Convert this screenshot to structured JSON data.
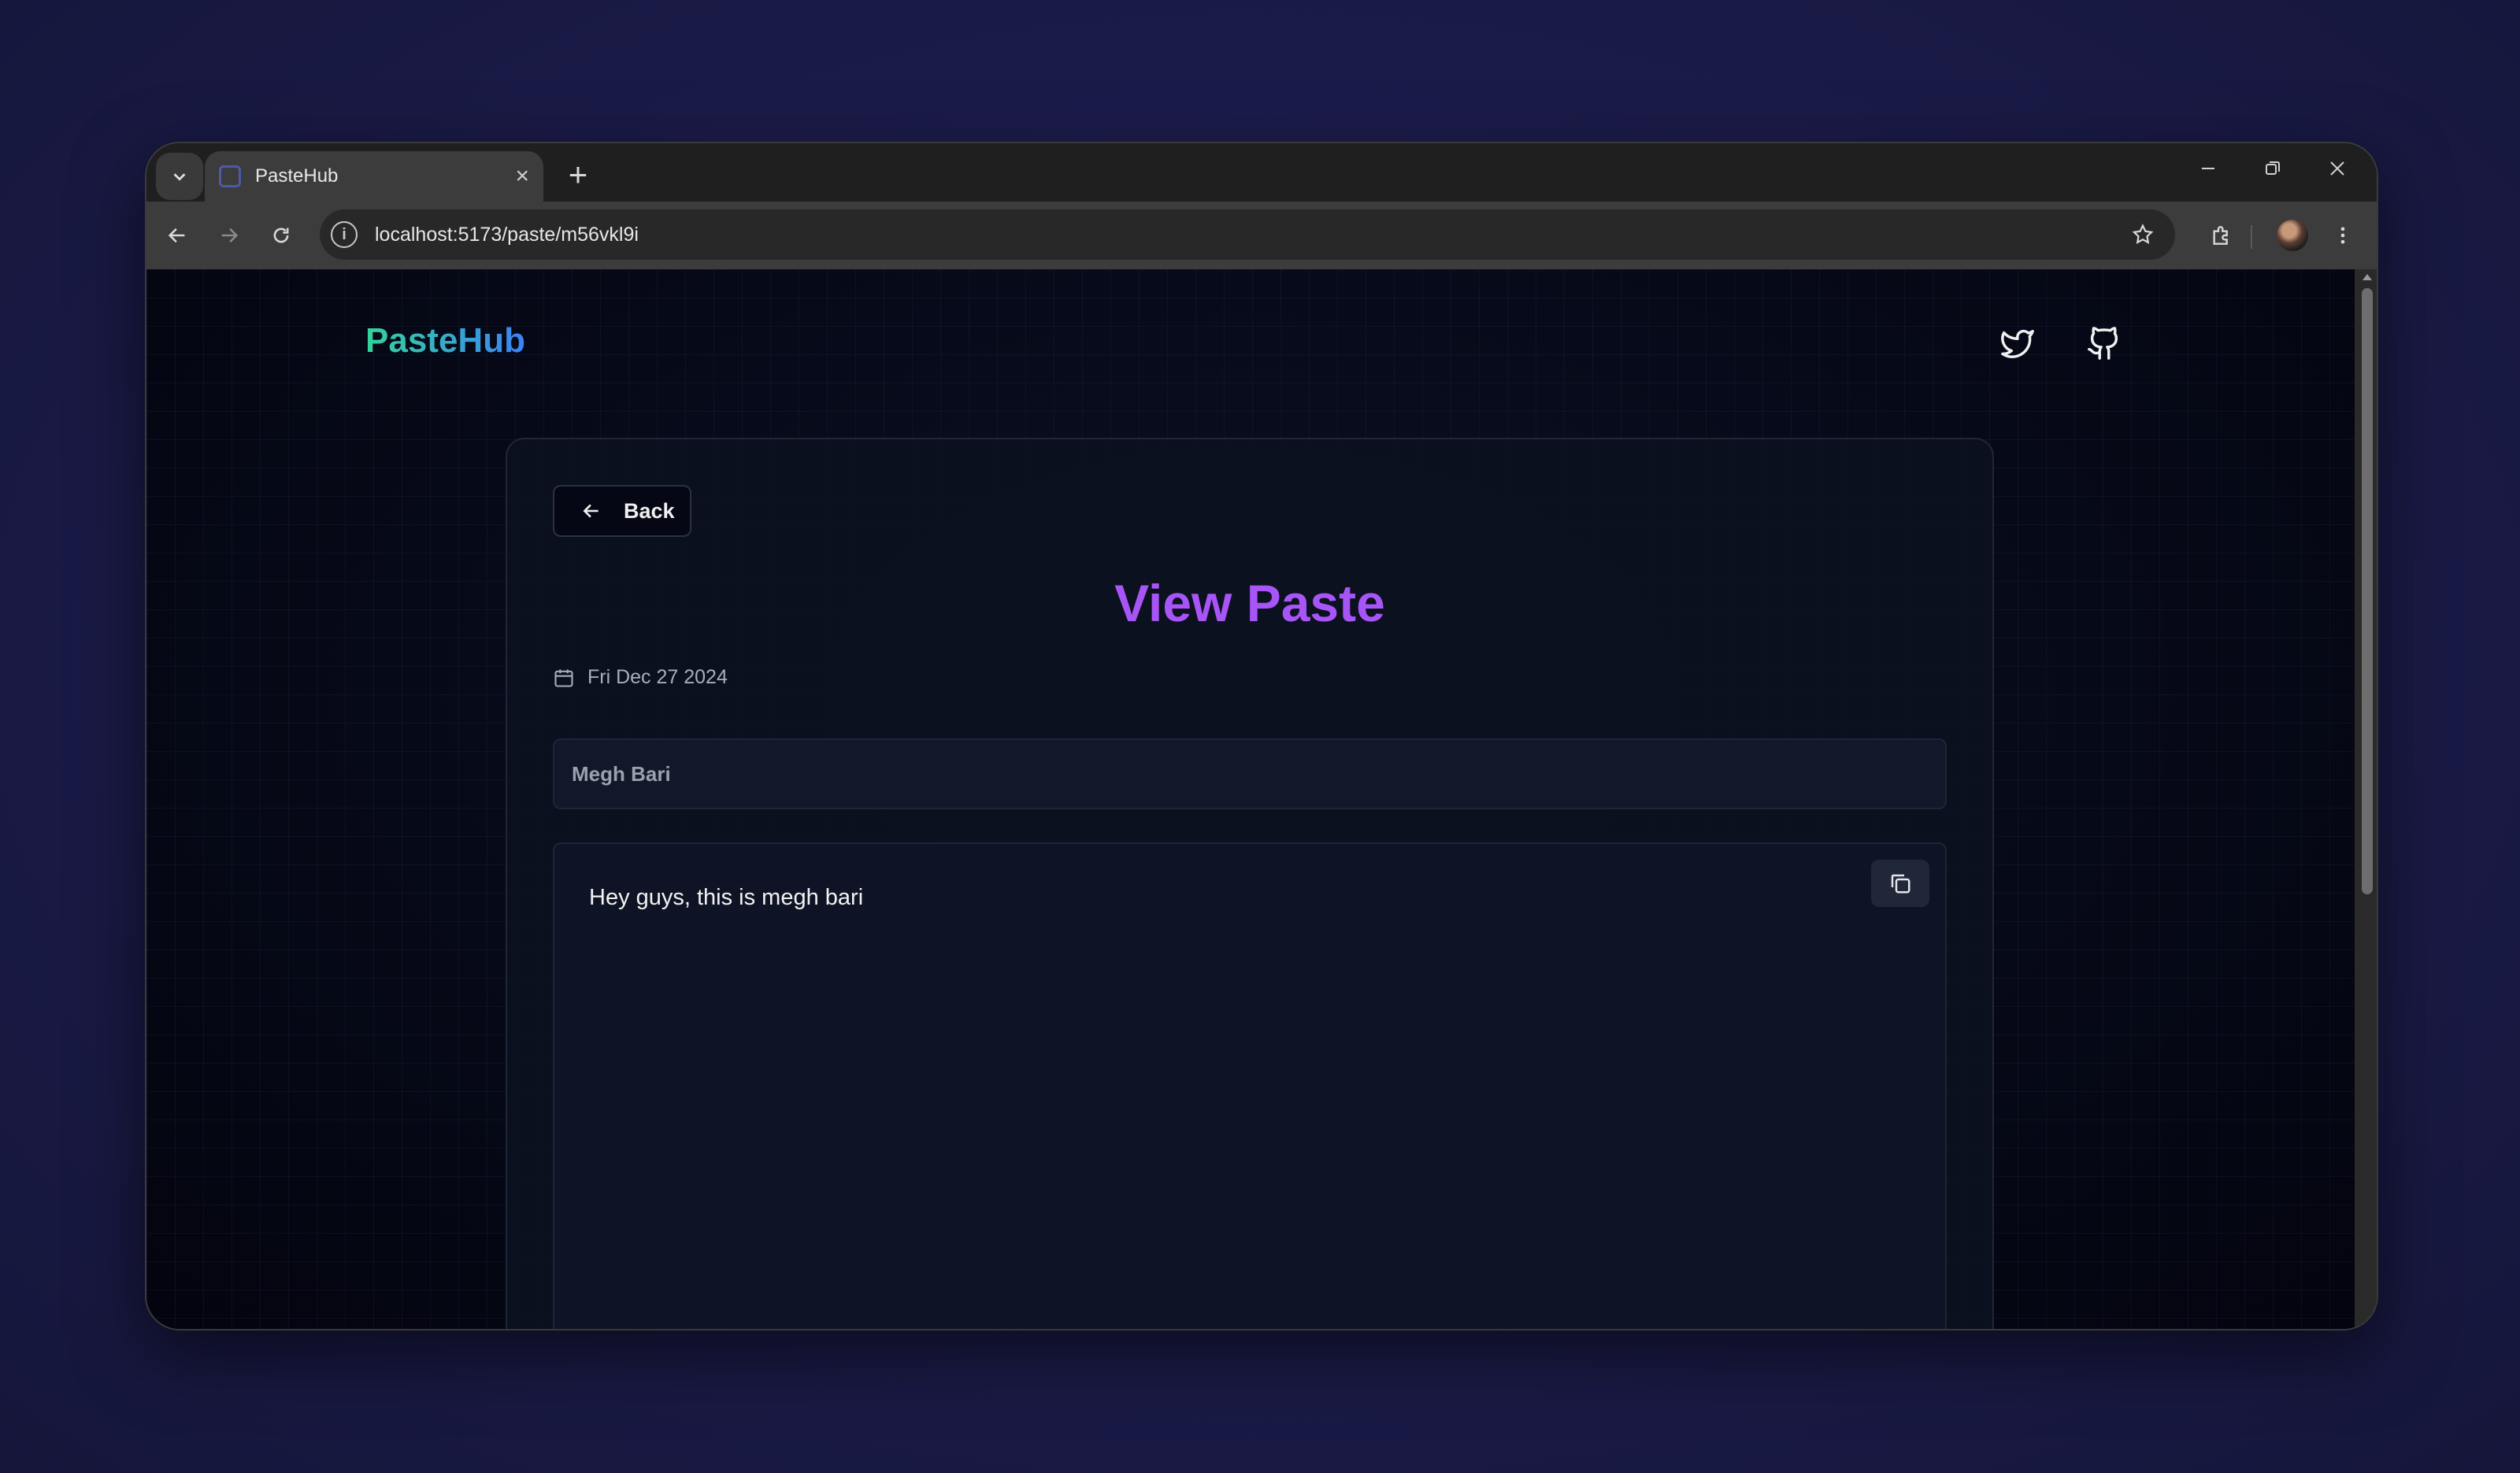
{
  "browser": {
    "tab_title": "PasteHub",
    "url": "localhost:5173/paste/m56vkl9i"
  },
  "header": {
    "logo_text": "PasteHub"
  },
  "paste": {
    "back_label": "Back",
    "page_title": "View Paste",
    "date": "Fri Dec 27 2024",
    "title_value": "Megh Bari",
    "content": "Hey guys, this is megh bari"
  },
  "icons": {
    "tab_search": "chevron-down-icon",
    "new_tab": "plus-icon",
    "back": "arrow-left-icon",
    "calendar": "calendar-icon",
    "copy": "copy-icon",
    "twitter": "twitter-icon",
    "github": "github-icon"
  },
  "colors": {
    "logo_gradient_start": "#34d399",
    "logo_gradient_end": "#3b82f6",
    "title": "#a855f7",
    "card_bg": "#0c1120"
  }
}
